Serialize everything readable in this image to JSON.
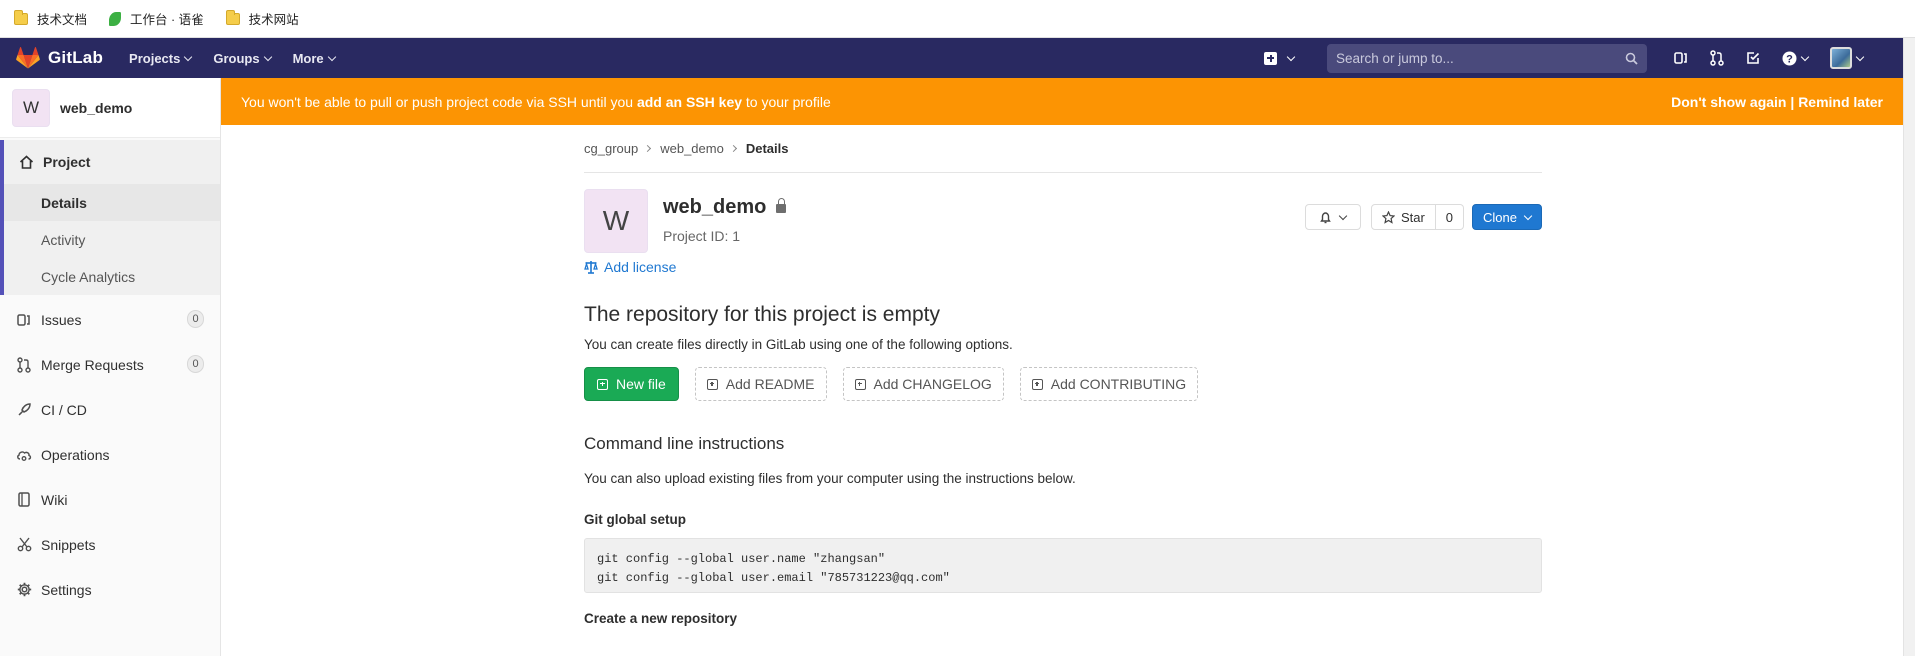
{
  "bookmarks": [
    {
      "label": "技术文档",
      "icon": "folder-icon"
    },
    {
      "label": "工作台 · 语雀",
      "icon": "yuque-leaf-icon"
    },
    {
      "label": "技术网站",
      "icon": "folder-icon"
    }
  ],
  "topnav": {
    "brand": "GitLab",
    "links": [
      "Projects",
      "Groups",
      "More"
    ],
    "search_placeholder": "Search or jump to...",
    "brand_color": "#292961"
  },
  "sidebar": {
    "avatar_letter": "W",
    "project_name": "web_demo",
    "project_label": "Project",
    "project_sub": [
      "Details",
      "Activity",
      "Cycle Analytics"
    ],
    "issues_label": "Issues",
    "issues_count": "0",
    "mr_label": "Merge Requests",
    "mr_count": "0",
    "cicd_label": "CI / CD",
    "operations_label": "Operations",
    "wiki_label": "Wiki",
    "snippets_label": "Snippets",
    "settings_label": "Settings"
  },
  "banner": {
    "text_before": "You won't be able to pull or push project code via SSH until you ",
    "link": "add an SSH key",
    "text_after": " to your profile",
    "dont_show": "Don't show again",
    "separator": " | ",
    "remind": "Remind later",
    "color": "#fc9403"
  },
  "breadcrumb": [
    "cg_group",
    "web_demo",
    "Details"
  ],
  "project": {
    "avatar_letter": "W",
    "title": "web_demo",
    "id_text": "Project ID: 1",
    "star_label": "Star",
    "star_count": "0",
    "clone_label": "Clone",
    "add_license": "Add license"
  },
  "empty_repo": {
    "heading": "The repository for this project is empty",
    "sub": "You can create files directly in GitLab using one of the following options.",
    "new_file": "New file",
    "add_readme": "Add README",
    "add_changelog": "Add CHANGELOG",
    "add_contributing": "Add CONTRIBUTING"
  },
  "cli": {
    "heading": "Command line instructions",
    "sub": "You can also upload existing files from your computer using the instructions below.",
    "global_setup": "Git global setup",
    "code_line1": "git config --global user.name \"zhangsan\"",
    "code_line2": "git config --global user.email \"785731223@qq.com\"",
    "create_repo": "Create a new repository"
  }
}
